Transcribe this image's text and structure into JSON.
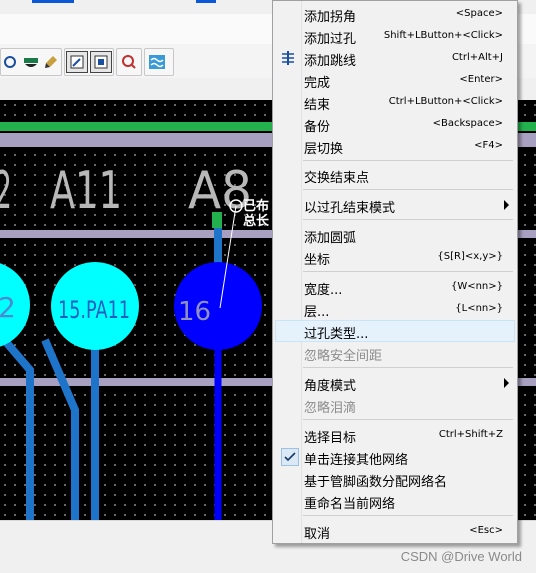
{
  "toolbar": {
    "buttons": [
      {
        "name": "view-icon"
      },
      {
        "name": "net-color-icon"
      },
      {
        "name": "brush-icon"
      },
      {
        "name": "interactive-route-icon"
      },
      {
        "name": "component-icon"
      },
      {
        "name": "design-rule-check-icon"
      },
      {
        "name": "wave-icon"
      }
    ]
  },
  "pcb": {
    "labels": [
      "2",
      "A11",
      "A8"
    ],
    "pads": [
      {
        "label": "2",
        "color": "#00ffff"
      },
      {
        "label": "15.PA11",
        "color": "#00ffff"
      },
      {
        "label": "16",
        "color": "#0000ff"
      }
    ],
    "tooltip": [
      "已布",
      "总长"
    ],
    "colors": {
      "green_layer": "#22b14c",
      "trace": "#1e74c8",
      "pad_cyan": "#00ffff",
      "pad_blue": "#0000ff",
      "band": "#a8a0c0"
    }
  },
  "context_menu": {
    "items": [
      {
        "label": "添加拐角",
        "shortcut": "<Space>"
      },
      {
        "label": "添加过孔",
        "shortcut": "Shift+LButton+<Click>"
      },
      {
        "label": "添加跳线",
        "shortcut": "Ctrl+Alt+J"
      },
      {
        "label": "完成",
        "shortcut": "<Enter>"
      },
      {
        "label": "结束",
        "shortcut": "Ctrl+LButton+<Click>"
      },
      {
        "label": "备份",
        "shortcut": "<Backspace>"
      },
      {
        "label": "层切换",
        "shortcut": "<F4>"
      },
      {
        "label": "交换结束点",
        "shortcut": ""
      },
      {
        "label": "以过孔结束模式",
        "shortcut": ""
      },
      {
        "label": "添加圆弧",
        "shortcut": ""
      },
      {
        "label": "坐标",
        "shortcut": "{S[R]<x,y>}"
      },
      {
        "label": "宽度...",
        "shortcut": "{W<nn>}"
      },
      {
        "label": "层...",
        "shortcut": "{L<nn>}"
      },
      {
        "label": "过孔类型...",
        "shortcut": ""
      },
      {
        "label": "忽略安全间距",
        "shortcut": ""
      },
      {
        "label": "角度模式",
        "shortcut": ""
      },
      {
        "label": "忽略泪滴",
        "shortcut": ""
      },
      {
        "label": "选择目标",
        "shortcut": "Ctrl+Shift+Z"
      },
      {
        "label": "单击连接其他网络",
        "shortcut": ""
      },
      {
        "label": "基于管脚函数分配网络名",
        "shortcut": ""
      },
      {
        "label": "重命名当前网络",
        "shortcut": ""
      },
      {
        "label": "取消",
        "shortcut": "<Esc>"
      }
    ],
    "highlighted_item": "过孔类型...",
    "checked_item": "单击连接其他网络",
    "disabled_items": [
      "忽略安全间距",
      "忽略泪滴"
    ]
  },
  "watermark": "CSDN @Drive World"
}
